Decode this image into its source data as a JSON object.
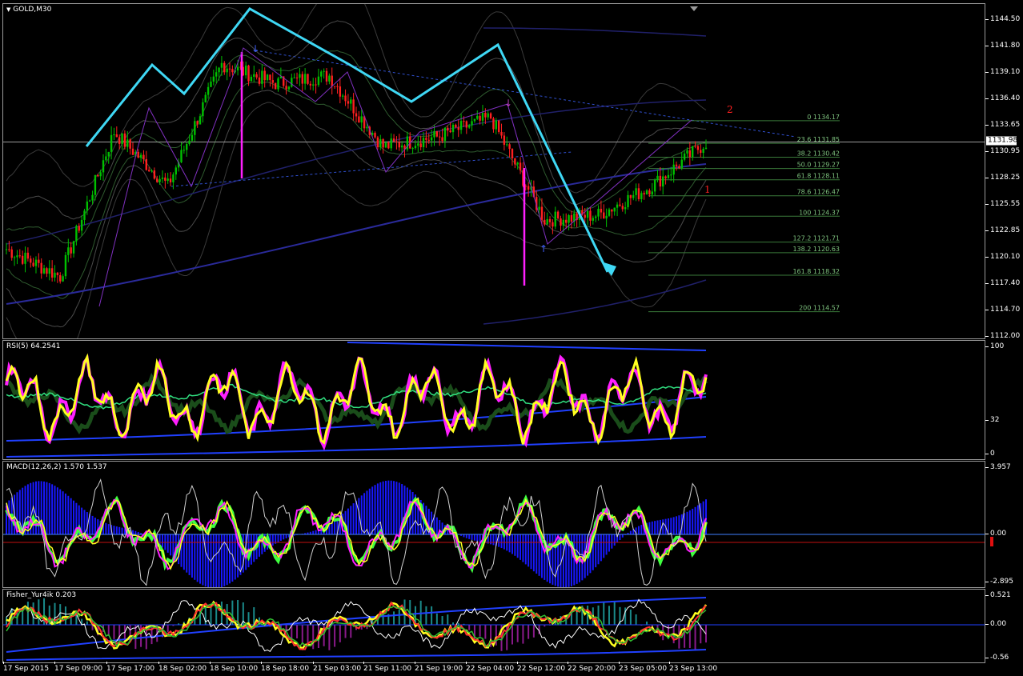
{
  "main_pane": {
    "title": "GOLD,M30",
    "current_price": "1131.98",
    "wave_label_1": "1",
    "wave_label_2": "2"
  },
  "price_axis": [
    "1144.50",
    "1141.80",
    "1139.10",
    "1136.40",
    "1133.65",
    "1130.95",
    "1128.25",
    "1125.55",
    "1122.85",
    "1120.10",
    "1117.40",
    "1114.70",
    "1112.00"
  ],
  "fib_levels": [
    {
      "label": "0 1134.17",
      "price": 1134.17
    },
    {
      "label": "23.6 1131.85",
      "price": 1131.85
    },
    {
      "label": "38.2 1130.42",
      "price": 1130.42
    },
    {
      "label": "50.0 1129.27",
      "price": 1129.27
    },
    {
      "label": "61.8 1128.11",
      "price": 1128.11
    },
    {
      "label": "78.6 1126.47",
      "price": 1126.47
    },
    {
      "label": "100 1124.37",
      "price": 1124.37
    },
    {
      "label": "127.2 1121.71",
      "price": 1121.71
    },
    {
      "label": "138.2 1120.63",
      "price": 1120.63
    },
    {
      "label": "161.8 1118.32",
      "price": 1118.32
    },
    {
      "label": "200 1114.57",
      "price": 1114.57
    }
  ],
  "rsi_pane": {
    "title": "RSI(5) 64.2541",
    "axis": [
      "100",
      "32",
      "0"
    ]
  },
  "macd_pane": {
    "title": "MACD(12,26,2) 1.570 1.537",
    "axis": [
      "3.957",
      "0.00",
      "-2.895"
    ]
  },
  "fisher_pane": {
    "title": "Fisher_Yur4ik 0.203",
    "axis": [
      "0.521",
      "0.00",
      "-0.56"
    ]
  },
  "time_axis": [
    "17 Sep 2015",
    "17 Sep 09:00",
    "17 Sep 17:00",
    "18 Sep 02:00",
    "18 Sep 10:00",
    "18 Sep 18:00",
    "21 Sep 03:00",
    "21 Sep 11:00",
    "21 Sep 19:00",
    "22 Sep 04:00",
    "22 Sep 12:00",
    "22 Sep 20:00",
    "23 Sep 05:00",
    "23 Sep 13:00"
  ],
  "colors": {
    "wave_arrow": "#3fd8f5",
    "bull": "#00c000",
    "bear": "#ff2020",
    "rsi": "#ffff20",
    "macd_hist": "#1818ff",
    "fib": "#3a7a3a"
  },
  "chart_data": {
    "type": "candlestick",
    "symbol": "GOLD",
    "timeframe": "M30",
    "ylim": [
      1112.0,
      1145.8
    ],
    "close_path": [
      {
        "x": "17 Sep 2015",
        "y": 1121.0
      },
      {
        "x": "17 Sep 09:00",
        "y": 1118.2
      },
      {
        "x": "17 Sep 17:00",
        "y": 1133.0
      },
      {
        "x": "18 Sep 02:00",
        "y": 1127.5
      },
      {
        "x": "18 Sep 10:00",
        "y": 1140.0
      },
      {
        "x": "18 Sep 18:00",
        "y": 1138.0
      },
      {
        "x": "21 Sep 03:00",
        "y": 1138.8
      },
      {
        "x": "21 Sep 11:00",
        "y": 1131.5
      },
      {
        "x": "21 Sep 19:00",
        "y": 1132.5
      },
      {
        "x": "22 Sep 04:00",
        "y": 1134.5
      },
      {
        "x": "22 Sep 12:00",
        "y": 1124.0
      },
      {
        "x": "22 Sep 20:00",
        "y": 1124.5
      },
      {
        "x": "23 Sep 05:00",
        "y": 1127.5
      },
      {
        "x": "23 Sep 13:00",
        "y": 1131.98
      }
    ]
  }
}
